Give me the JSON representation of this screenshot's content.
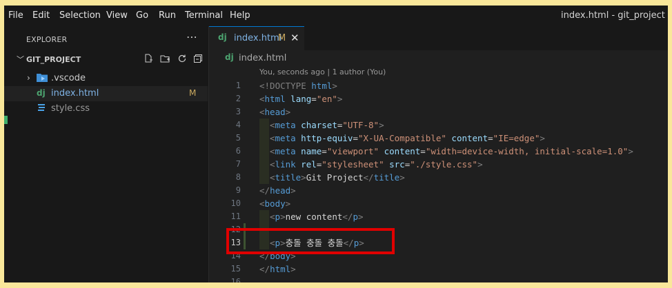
{
  "menu": {
    "items": [
      "File",
      "Edit",
      "Selection",
      "View",
      "Go",
      "Run",
      "Terminal",
      "Help"
    ],
    "window_title": "index.html - git_project - Visu"
  },
  "sidebar": {
    "title": "EXPLORER",
    "more_icon": "ellipsis-icon",
    "project_name": "GIT_PROJECT",
    "actions": [
      "new-file-icon",
      "new-folder-icon",
      "refresh-icon",
      "collapse-all-icon"
    ],
    "items": [
      {
        "label": ".vscode",
        "icon": "vscode-folder-icon",
        "badge": ""
      },
      {
        "label": "index.html",
        "icon": "dj",
        "badge": "M"
      },
      {
        "label": "style.css",
        "icon": "css-icon",
        "badge": ""
      }
    ]
  },
  "editor": {
    "tab": {
      "label": "index.html",
      "modified": "M",
      "icon": "dj"
    },
    "breadcrumb": {
      "icon": "dj",
      "label": "index.html"
    },
    "blame": "You, seconds ago | 1 author (You)",
    "line_numbers": [
      "1",
      "2",
      "3",
      "4",
      "5",
      "6",
      "7",
      "8",
      "9",
      "10",
      "11",
      "12",
      "13",
      "14",
      "15",
      "16"
    ],
    "lines": {
      "l1": {
        "open": "<!DOCTYPE ",
        "tag": "html",
        "close": ">"
      },
      "l2": {
        "open": "<",
        "tag": "html",
        "attr": " lang",
        "eq": "=",
        "val": "\"en\"",
        "close": ">"
      },
      "l3": {
        "open": "<",
        "tag": "head",
        "close": ">"
      },
      "l4": {
        "open": "<",
        "tag": "meta",
        "attr": " charset",
        "eq": "=",
        "val": "\"UTF-8\"",
        "close": ">"
      },
      "l5": {
        "open": "<",
        "tag": "meta",
        "attr1": " http-equiv",
        "val1": "\"X-UA-Compatible\"",
        "attr2": " content",
        "val2": "\"IE=edge\"",
        "close": ">"
      },
      "l6": {
        "open": "<",
        "tag": "meta",
        "attr1": " name",
        "val1": "\"viewport\"",
        "attr2": " content",
        "val2": "\"width=device-width, initial-scale=1.0\"",
        "close": ">"
      },
      "l7": {
        "open": "<",
        "tag": "link",
        "attr1": " rel",
        "val1": "\"stylesheet\"",
        "attr2": " src",
        "val2": "\"./style.css\"",
        "close": ">"
      },
      "l8": {
        "open": "<",
        "tag": "title",
        "text": "Git Project",
        "closetag": "</",
        "tag2": "title",
        "close": ">"
      },
      "l9": {
        "open": "</",
        "tag": "head",
        "close": ">"
      },
      "l10": {
        "open": "<",
        "tag": "body",
        "close": ">"
      },
      "l11": {
        "open": "<",
        "tag": "p",
        "text": "new content",
        "closetag": "</",
        "tag2": "p",
        "close": ">"
      },
      "l13": {
        "open": "<",
        "tag": "p",
        "text": "충돌 충돌 충돌",
        "closetag": "</",
        "tag2": "p",
        "close": ">"
      },
      "l14": {
        "open": "</",
        "tag": "body",
        "close": ">"
      },
      "l15": {
        "open": "</",
        "tag": "html",
        "close": ">"
      }
    }
  },
  "colors": {
    "background_frame": "#f9e79a",
    "highlight_box": "#e00000",
    "tag": "#569cd6",
    "attribute": "#9cdcfe",
    "string": "#ce9178",
    "modified_badge": "#c9a85e"
  }
}
